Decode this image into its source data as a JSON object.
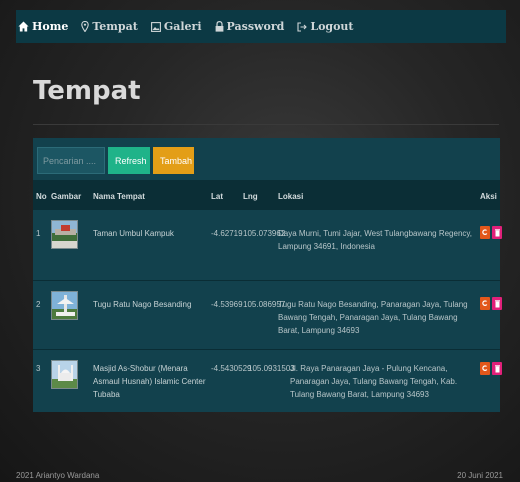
{
  "nav": {
    "items": [
      {
        "label": "Home",
        "icon": "home-icon"
      },
      {
        "label": "Tempat",
        "icon": "map-marker-icon"
      },
      {
        "label": "Galeri",
        "icon": "image-icon"
      },
      {
        "label": "Password",
        "icon": "lock-icon"
      },
      {
        "label": "Logout",
        "icon": "logout-icon"
      }
    ]
  },
  "page": {
    "title": "Tempat"
  },
  "toolbar": {
    "search_placeholder": "Pencarian ....",
    "refresh_label": "Refresh",
    "add_label": "Tambah"
  },
  "table": {
    "headers": [
      "No",
      "Gambar",
      "Nama Tempat",
      "Lat",
      "Lng",
      "Lokasi",
      "Aksi"
    ],
    "rows": [
      {
        "no": "1",
        "name": "Taman Umbul Kampuk",
        "lat": "-4.62719",
        "lng": "105.073962",
        "lokasi": "Daya Murni, Tumi Jajar, West Tulangbawang Regency, Lampung 34691, Indonesia"
      },
      {
        "no": "2",
        "name": "Tugu Ratu Nago Besanding",
        "lat": "-4.53969",
        "lng": "105.086957",
        "lokasi": "Tugu Ratu Nago Besanding, Panaragan Jaya, Tulang Bawang Tengah, Panaragan Jaya, Tulang Bawang Barat, Lampung 34693"
      },
      {
        "no": "3",
        "name": "Masjid As-Shobur (Menara Asmaul Husnah) Islamic Center Tubaba",
        "lat": "-4.5430529",
        "lng": "105.0931503",
        "lokasi": "Jl. Raya Panaragan Jaya - Pulung Kencana, Panaragan Jaya, Tulang Bawang Tengah, Kab. Tulang Bawang Barat, Lampung 34693"
      }
    ]
  },
  "footer": {
    "left": "2021 Ariantyo Wardana",
    "right": "20 Juni 2021"
  },
  "colors": {
    "navbar": "#0c3944",
    "panel": "#12414d",
    "refresh": "#1fb389",
    "add": "#e39e17",
    "edit": "#e2571b",
    "delete": "#e2207a"
  }
}
